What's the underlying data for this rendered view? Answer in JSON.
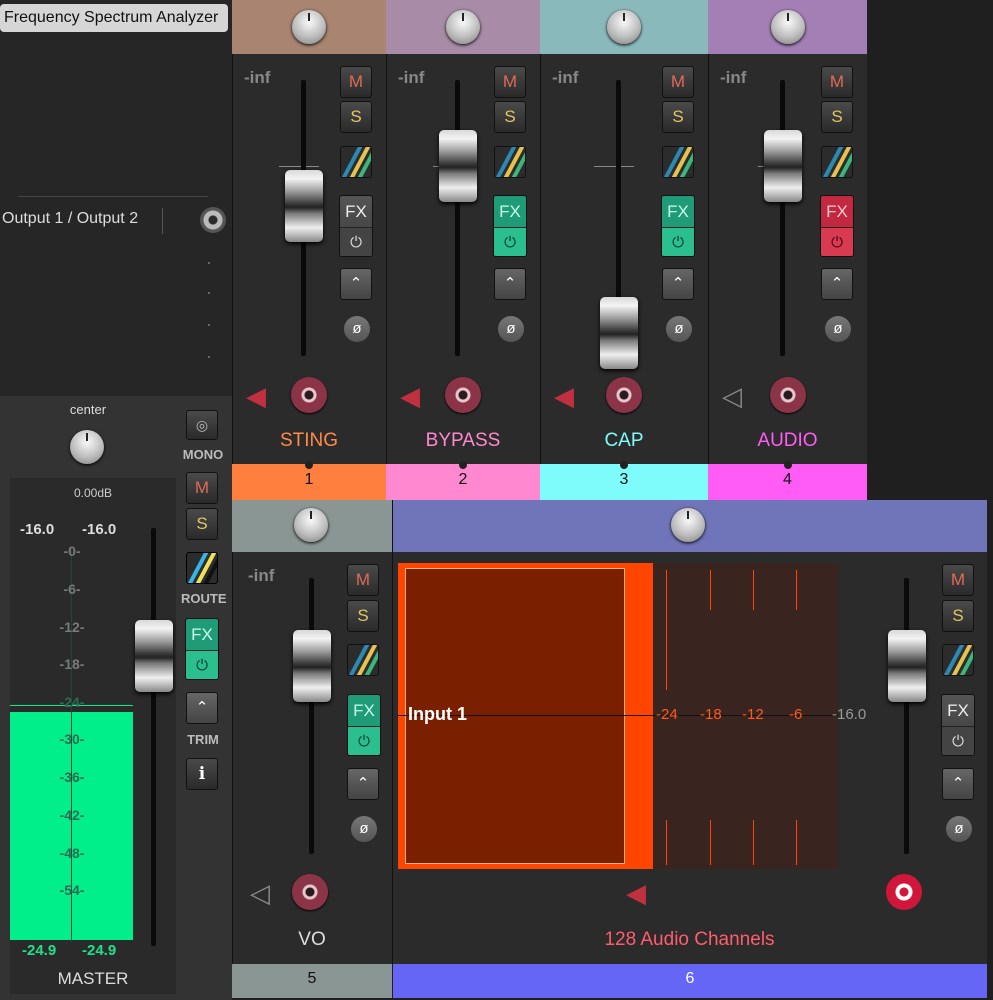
{
  "plugin": {
    "title": "Frequency Spectrum Analyzer",
    "output_label": "Output 1 / Output 2"
  },
  "master": {
    "pan_label": "center",
    "db_label": "0.00dB",
    "peak_left": "-16.0",
    "peak_right": "-16.0",
    "scale": [
      "-0-",
      "-6-",
      "-12-",
      "-18-",
      "-24-",
      "-30-",
      "-36-",
      "-42-",
      "-48-",
      "-54-"
    ],
    "level_left": "-24.9",
    "level_right": "-24.9",
    "name": "MASTER",
    "mono_label": "MONO",
    "route_label": "ROUTE",
    "trim_label": "TRIM",
    "mute_label": "M",
    "solo_label": "S",
    "fx_label": "FX",
    "info_label": "i",
    "meter_color": "#00ef8a"
  },
  "common": {
    "mute": "M",
    "solo": "S",
    "fx": "FX",
    "power": "⏻",
    "phase": "ø",
    "env": "⌃",
    "inf": "-inf"
  },
  "tracks": [
    {
      "name": "STING",
      "number": "1",
      "color": "#ff7f3e",
      "header": "#a88471",
      "name_color": "#ff8a4a",
      "fx_state": "off"
    },
    {
      "name": "BYPASS",
      "number": "2",
      "color": "#ff88d0",
      "header": "#a88ba6",
      "name_color": "#ff88d0",
      "fx_state": "on"
    },
    {
      "name": "CAP",
      "number": "3",
      "color": "#7efcfc",
      "header": "#8ab9bc",
      "name_color": "#7efcfc",
      "fx_state": "on"
    },
    {
      "name": "AUDIO",
      "number": "4",
      "color": "#ff5cf6",
      "header": "#a37fb6",
      "name_color": "#ff5cf6",
      "fx_state": "bypass"
    },
    {
      "name": "VO",
      "number": "5",
      "color": "#8a9694",
      "header": "#8a9694",
      "name_color": "#dddddd",
      "fx_state": "on"
    }
  ],
  "folder": {
    "name": "128 Audio Channels",
    "number": "6",
    "color": "#6566f5",
    "header": "#7074b8",
    "name_color": "#ff5c6e",
    "input_label": "Input 1",
    "meter_scale": [
      "-24",
      "-18",
      "-12",
      "-6"
    ],
    "meter_value": "-16.0",
    "input_level": 0.62
  }
}
